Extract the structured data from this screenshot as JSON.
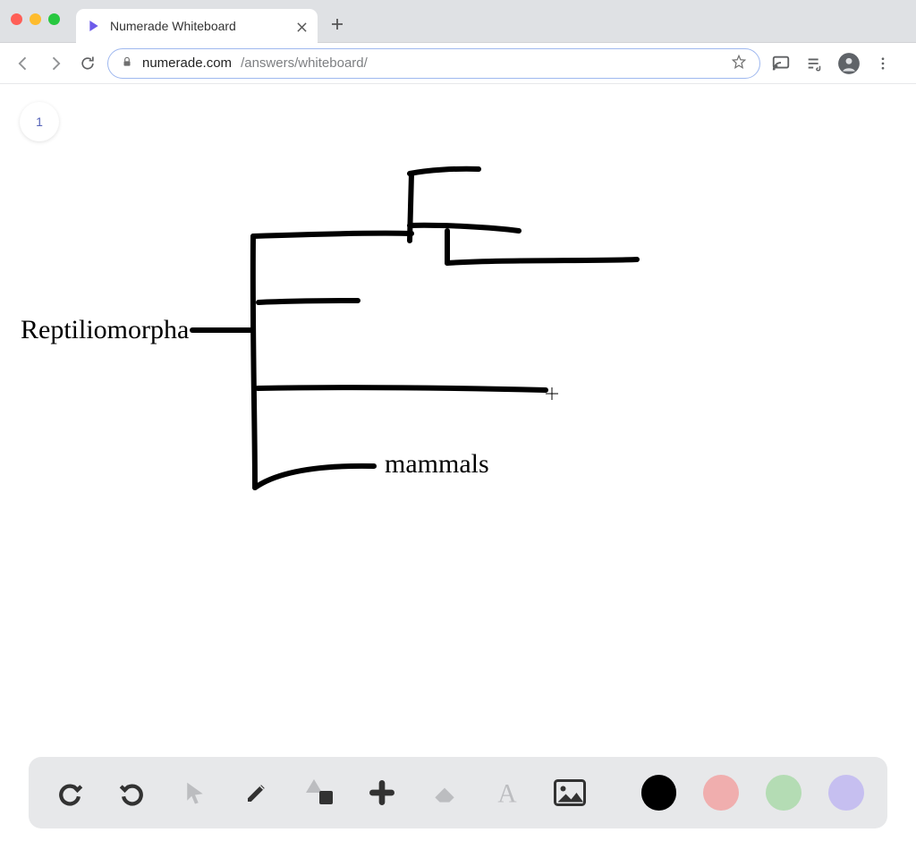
{
  "window": {
    "tab_title": "Numerade Whiteboard"
  },
  "address": {
    "domain": "numerade.com",
    "path": "/answers/whiteboard/"
  },
  "page_badge": "1",
  "labels": {
    "left": "Reptiliomorpha",
    "bottom": "mammals"
  },
  "toolbar_icons": {
    "undo": "undo-icon",
    "redo": "redo-icon",
    "pointer": "pointer-icon",
    "pencil": "pencil-icon",
    "shapes": "shapes-icon",
    "plus": "plus-icon",
    "eraser": "eraser-icon",
    "text": "text-icon",
    "image": "image-icon"
  },
  "colors": {
    "black": "#000000",
    "red": "#f0aeae",
    "green": "#b4dcb4",
    "purple": "#c6bff0"
  }
}
